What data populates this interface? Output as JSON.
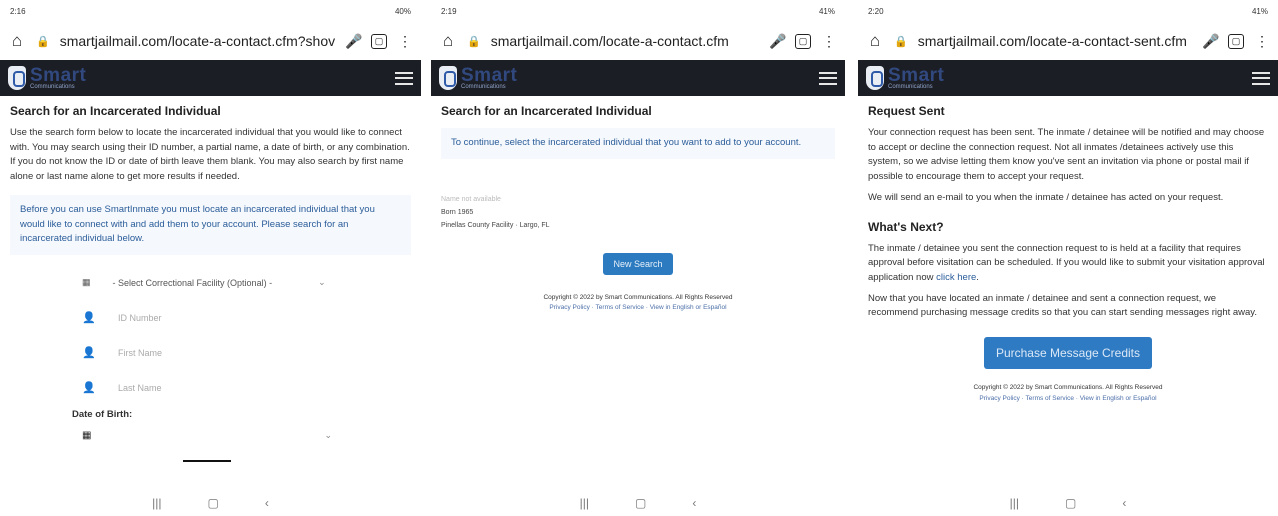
{
  "panels": [
    {
      "status_time": "2:16",
      "status_right": "40%",
      "url": "smartjailmail.com/locate-a-contact.cfm?shoᴠ"
    },
    {
      "status_time": "2:19",
      "status_right": "41%",
      "url": "smartjailmail.com/locate-a-contact.cfm"
    },
    {
      "status_time": "2:20",
      "status_right": "41%",
      "url": "smartjailmail.com/locate-a-contact-sent.cfm"
    }
  ],
  "logo": {
    "big": "Smart",
    "small": "Communications"
  },
  "search": {
    "title": "Search for an Incarcerated Individual",
    "intro": "Use the search form below to locate the incarcerated individual that you would like to connect with. You may search using their ID number, a partial name, a date of birth, or any combination. If you do not know the ID or date of birth leave them blank. You may also search by first name alone or last name alone to get more results if needed.",
    "notice": "Before you can use SmartInmate you must locate an incarcerated individual that you would like to connect with and add them to your account. Please search for an incarcerated individual below.",
    "facility_select": "- Select Correctional Facility (Optional) -",
    "id_placeholder": "ID Number",
    "first_placeholder": "First Name",
    "last_placeholder": "Last Name",
    "dob_label": "Date of Birth:"
  },
  "results": {
    "title": "Search for an Incarcerated Individual",
    "notice": "To continue, select the incarcerated individual that you want to add to your account.",
    "line1": "Name not available",
    "line2": "Born 1965",
    "line3": "Pinellas County Facility · Largo, FL",
    "new_search": "New Search",
    "copyright": "Copyright © 2022 by Smart Communications. All Rights Reserved",
    "footer_links": "Privacy Policy · Terms of Service · View in English or Español"
  },
  "sent": {
    "title": "Request Sent",
    "p1": "Your connection request has been sent. The inmate / detainee will be notified and may choose to accept or decline the connection request. Not all inmates /detainees actively use this system, so we advise letting them know you've sent an invitation via phone or postal mail if possible to encourage them to accept your request.",
    "p2": "We will send an e-mail to you when the inmate / detainee has acted on your request.",
    "whats_next": "What's Next?",
    "p3_text": "The inmate / detainee you sent the connection request to is held at a facility that requires approval before visitation can be scheduled. If you would like to submit your visitation approval application now",
    "p3_link": "click here",
    "p4": "Now that you have located an inmate / detainee and sent a connection request, we recommend purchasing message credits so that you can start sending messages right away.",
    "purchase_button": "Purchase Message Credits",
    "copyright": "Copyright © 2022 by Smart Communications. All Rights Reserved",
    "footer_links": "Privacy Policy · Terms of Service · View in English or Español"
  },
  "icons": {
    "home": "home-icon",
    "lock": "lock-icon",
    "mic": "microphone-icon",
    "tabs": "tabs-icon",
    "more": "more-vertical-icon",
    "menu": "hamburger-menu-icon",
    "building": "building-icon",
    "person": "person-icon",
    "calendar": "calendar-icon"
  }
}
